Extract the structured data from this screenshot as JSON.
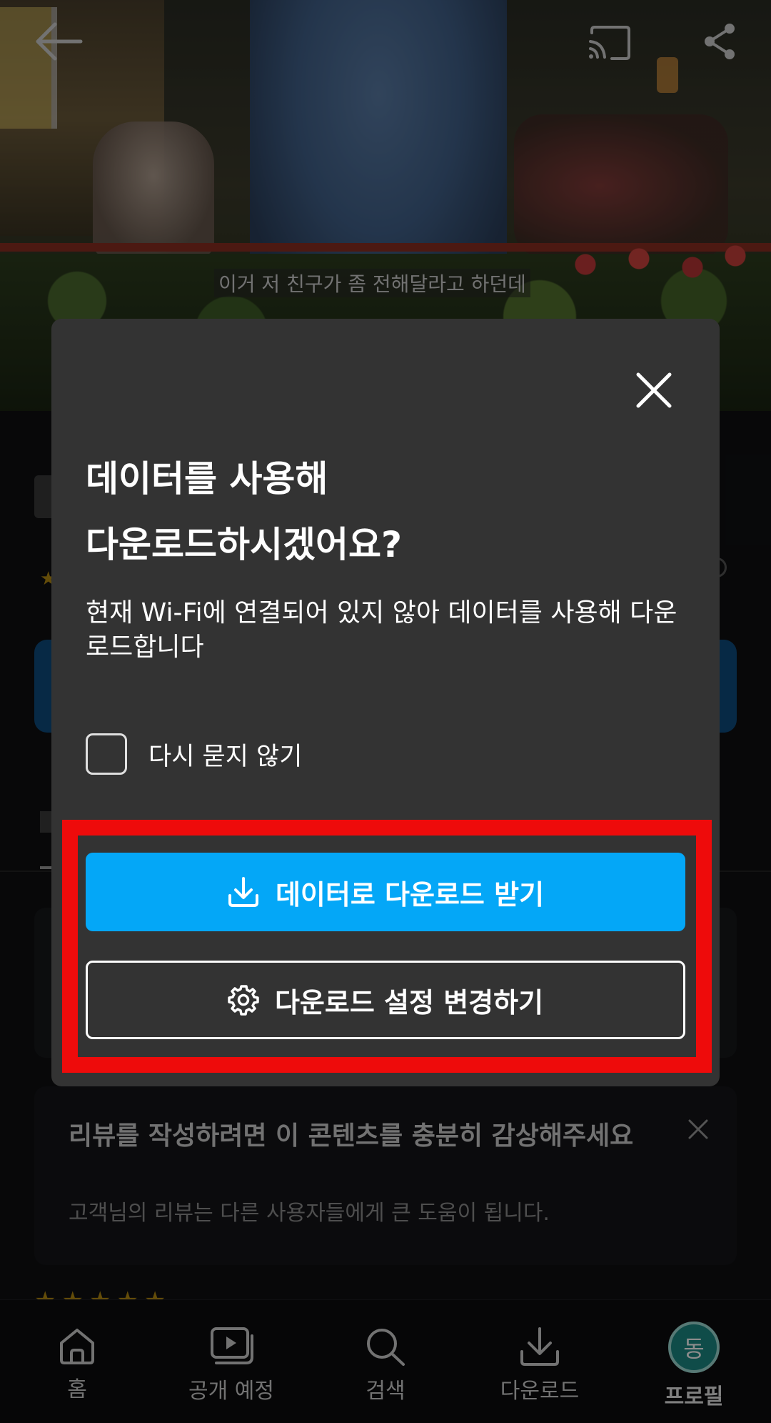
{
  "video": {
    "subtitle": "이거 저 친구가 좀 전해달라고 하던데"
  },
  "topbar": {
    "back_icon": "arrow-left-icon",
    "cast_icon": "cast-icon",
    "share_icon": "share-icon"
  },
  "modal": {
    "title_line1": "데이터를 사용해",
    "title_line2": "다운로드하시겠어요?",
    "body": "현재 Wi-Fi에 연결되어 있지 않아 데이터를 사용해 다운로드합니다",
    "checkbox_label": "다시 묻지 않기",
    "primary_button": "데이터로 다운로드 받기",
    "secondary_button": "다운로드 설정 변경하기",
    "primary_color": "#04a7f7",
    "highlight_color": "#ee0b0b"
  },
  "review_card": {
    "title": "리뷰를 작성하려면 이 콘텐츠를 충분히 감상해주세요",
    "subtitle": "고객님의 리뷰는 다른 사용자들에게 큰 도움이 됩니다."
  },
  "bottom_nav": {
    "items": [
      {
        "label": "홈",
        "icon": "home-icon"
      },
      {
        "label": "공개 예정",
        "icon": "play-stack-icon"
      },
      {
        "label": "검색",
        "icon": "search-icon"
      },
      {
        "label": "다운로드",
        "icon": "download-icon"
      },
      {
        "label": "프로필",
        "icon": "avatar",
        "avatar_text": "동"
      }
    ]
  }
}
